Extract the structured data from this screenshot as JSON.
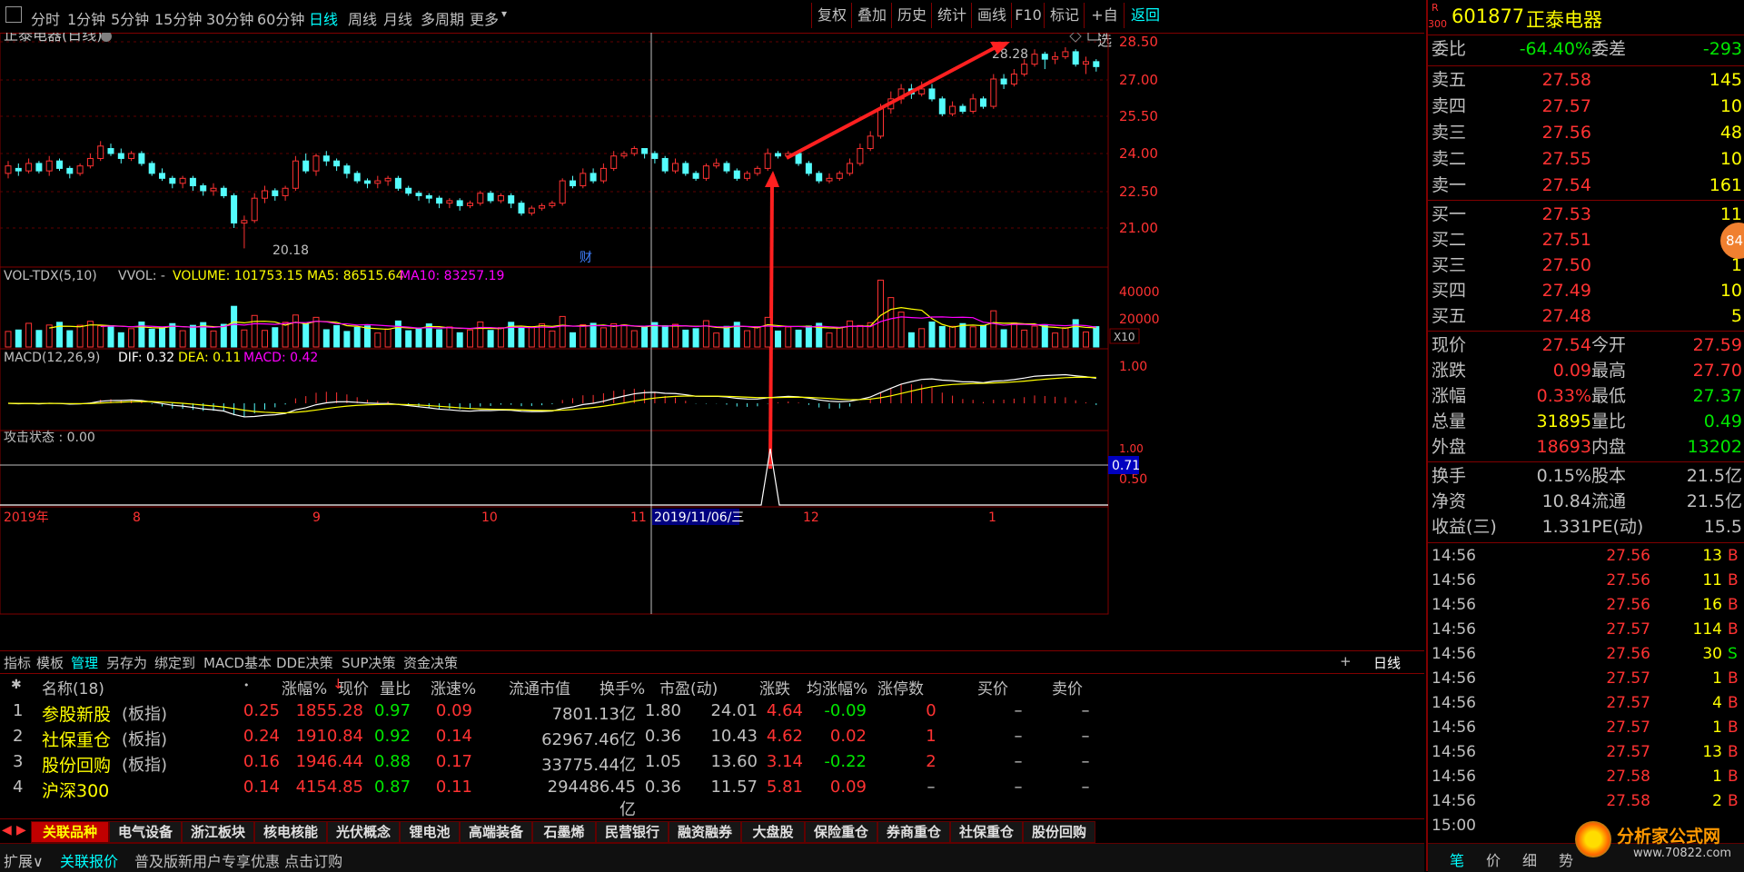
{
  "topbar": {
    "periods": [
      "分时",
      "1分钟",
      "5分钟",
      "15分钟",
      "30分钟",
      "60分钟",
      "日线",
      "周线",
      "月线",
      "多周期",
      "更多"
    ],
    "active_period": "日线",
    "buttons": [
      "复权",
      "叠加",
      "历史",
      "统计",
      "画线",
      "F10",
      "标记",
      "+自选",
      "返回"
    ]
  },
  "chart": {
    "title": "正泰电器(日线)",
    "price_ticks": [
      "28.50",
      "27.00",
      "25.50",
      "24.00",
      "22.50",
      "21.00"
    ],
    "low_label": "20.18",
    "high_label": "28.28",
    "fin_marker": "财",
    "vol_header": {
      "name": "VOL-TDX(5,10)",
      "vvol": "VVOL: -",
      "volume": "VOLUME: 101753.15",
      "ma5": "MA5: 86515.64",
      "ma10": "MA10: 83257.19"
    },
    "vol_ticks": [
      "40000",
      "20000"
    ],
    "vol_unit": "X10",
    "macd_header": {
      "name": "MACD(12,26,9)",
      "dif": "DIF: 0.32",
      "dea": "DEA: 0.11",
      "macd": "MACD: 0.42"
    },
    "macd_ticks": [
      "1.00"
    ],
    "attack_header": "攻击状态 : 0.00",
    "attack_ticks": [
      "1.00",
      "0.50"
    ],
    "attack_value": "0.71",
    "date_labels": [
      "2019年",
      "8",
      "9",
      "10",
      "11",
      "12",
      "1"
    ],
    "crosshair_date": "2019/11/06/三",
    "period_label": "日线"
  },
  "tooltabs": [
    "指标",
    "模板",
    "管理",
    "另存为",
    "绑定到",
    "MACD基本",
    "DDE决策",
    "SUP决策",
    "资金决策"
  ],
  "tooltab_active": "管理",
  "table": {
    "headers": [
      "名称(18)",
      "•",
      "涨幅%",
      "现价",
      "量比",
      "涨速%",
      "流通市值",
      "换手%",
      "市盈(动)",
      "涨跌",
      "均涨幅%",
      "涨停数",
      "买价",
      "卖价"
    ],
    "rows": [
      {
        "no": "1",
        "name": "参股新股",
        "tag": "(板指)",
        "chg": "0.25",
        "price": "1855.28",
        "lb": "0.97",
        "spd": "0.09",
        "mcap": "7801.13亿",
        "turn": "1.80",
        "pe": "24.01",
        "diff": "4.64",
        "avg": "-0.09",
        "limit": "0",
        "buy": "–",
        "sell": "–"
      },
      {
        "no": "2",
        "name": "社保重仓",
        "tag": "(板指)",
        "chg": "0.24",
        "price": "1910.84",
        "lb": "0.92",
        "spd": "0.14",
        "mcap": "62967.46亿",
        "turn": "0.36",
        "pe": "10.43",
        "diff": "4.62",
        "avg": "0.02",
        "limit": "1",
        "buy": "–",
        "sell": "–"
      },
      {
        "no": "3",
        "name": "股份回购",
        "tag": "(板指)",
        "chg": "0.16",
        "price": "1946.44",
        "lb": "0.88",
        "spd": "0.17",
        "mcap": "33775.44亿",
        "turn": "1.05",
        "pe": "13.60",
        "diff": "3.14",
        "avg": "-0.22",
        "limit": "2",
        "buy": "–",
        "sell": "–"
      },
      {
        "no": "4",
        "name": "沪深300",
        "tag": "",
        "chg": "0.14",
        "price": "4154.85",
        "lb": "0.87",
        "spd": "0.11",
        "mcap": "294486.45亿",
        "turn": "0.36",
        "pe": "11.57",
        "diff": "5.81",
        "avg": "0.09",
        "limit": "–",
        "buy": "–",
        "sell": "–"
      }
    ]
  },
  "bottom_tabs": [
    "关联品种",
    "电气设备",
    "浙江板块",
    "核电核能",
    "光伏概念",
    "锂电池",
    "高端装备",
    "石墨烯",
    "民营银行",
    "融资融券",
    "大盘股",
    "保险重仓",
    "券商重仓",
    "社保重仓",
    "股份回购"
  ],
  "status": [
    "扩展∨",
    "关联报价",
    "普及版新用户专享优惠 点击订购"
  ],
  "stock": {
    "badge_top": "R",
    "badge_bottom": "300",
    "code": "601877",
    "name": "正泰电器"
  },
  "ratio": {
    "wb_label": "委比",
    "wb_val": "-64.40%",
    "wc_label": "委差",
    "wc_val": "-293"
  },
  "sells": [
    {
      "label": "卖五",
      "price": "27.58",
      "vol": "145"
    },
    {
      "label": "卖四",
      "price": "27.57",
      "vol": "10"
    },
    {
      "label": "卖三",
      "price": "27.56",
      "vol": "48"
    },
    {
      "label": "卖二",
      "price": "27.55",
      "vol": "10"
    },
    {
      "label": "卖一",
      "price": "27.54",
      "vol": "161"
    }
  ],
  "buys": [
    {
      "label": "买一",
      "price": "27.53",
      "vol": "11"
    },
    {
      "label": "买二",
      "price": "27.51",
      "vol": "1"
    },
    {
      "label": "买三",
      "price": "27.50",
      "vol": "1"
    },
    {
      "label": "买四",
      "price": "27.49",
      "vol": "10"
    },
    {
      "label": "买五",
      "price": "27.48",
      "vol": "5"
    }
  ],
  "float_badge": "84",
  "quote": [
    {
      "l": "现价",
      "v": "27.54",
      "vc": "red",
      "l2": "今开",
      "v2": "27.59",
      "v2c": "red"
    },
    {
      "l": "涨跌",
      "v": "0.09",
      "vc": "red",
      "l2": "最高",
      "v2": "27.70",
      "v2c": "red"
    },
    {
      "l": "涨幅",
      "v": "0.33%",
      "vc": "red",
      "l2": "最低",
      "v2": "27.37",
      "v2c": "green"
    },
    {
      "l": "总量",
      "v": "31895",
      "vc": "yellow",
      "l2": "量比",
      "v2": "0.49",
      "v2c": "green"
    },
    {
      "l": "外盘",
      "v": "18693",
      "vc": "red",
      "l2": "内盘",
      "v2": "13202",
      "v2c": "green"
    }
  ],
  "quote2": [
    {
      "l": "换手",
      "v": "0.15%",
      "l2": "股本",
      "v2": "21.5亿"
    },
    {
      "l": "净资",
      "v": "10.84",
      "l2": "流通",
      "v2": "21.5亿"
    },
    {
      "l": "收益(三)",
      "v": "1.331",
      "l2": "PE(动)",
      "v2": "15.5"
    }
  ],
  "ticks": [
    {
      "t": "14:56",
      "p": "27.56",
      "v": "13",
      "s": "B"
    },
    {
      "t": "14:56",
      "p": "27.56",
      "v": "11",
      "s": "B"
    },
    {
      "t": "14:56",
      "p": "27.56",
      "v": "16",
      "s": "B"
    },
    {
      "t": "14:56",
      "p": "27.57",
      "v": "114",
      "s": "B"
    },
    {
      "t": "14:56",
      "p": "27.56",
      "v": "30",
      "s": "S"
    },
    {
      "t": "14:56",
      "p": "27.57",
      "v": "1",
      "s": "B"
    },
    {
      "t": "14:56",
      "p": "27.57",
      "v": "4",
      "s": "B"
    },
    {
      "t": "14:56",
      "p": "27.57",
      "v": "1",
      "s": "B"
    },
    {
      "t": "14:56",
      "p": "27.57",
      "v": "13",
      "s": "B"
    },
    {
      "t": "14:56",
      "p": "27.58",
      "v": "1",
      "s": "B"
    },
    {
      "t": "14:56",
      "p": "27.58",
      "v": "2",
      "s": "B"
    },
    {
      "t": "15:00",
      "p": "",
      "v": "",
      "s": ""
    }
  ],
  "rbottom_tabs": [
    "笔",
    "价",
    "细",
    "势"
  ],
  "watermark": {
    "main": "分析家公式网",
    "url": "www.70822.com"
  },
  "colors": {
    "up": "#ff3232",
    "down": "#54fcfc",
    "frame": "#800000",
    "ma_white": "#ffffff",
    "ma_yellow": "#ffff00",
    "ma_magenta": "#ff00ff",
    "arrow": "#ff2020"
  }
}
